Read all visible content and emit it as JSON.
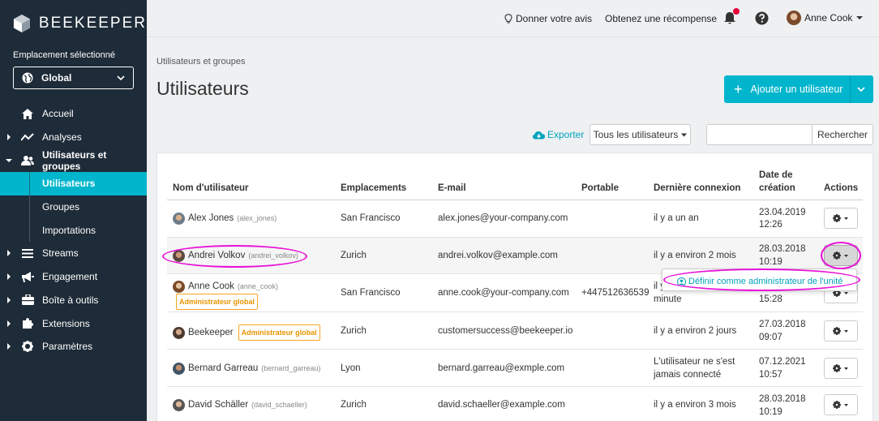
{
  "brand": {
    "name": "BEEKEEPER"
  },
  "sidebar": {
    "location_label": "Emplacement sélectionné",
    "location_value": "Global",
    "items": [
      {
        "label": "Accueil",
        "icon": "home-icon"
      },
      {
        "label": "Analyses",
        "icon": "chart-icon"
      },
      {
        "label": "Utilisateurs et groupes",
        "icon": "users-icon"
      },
      {
        "label": "Utilisateurs"
      },
      {
        "label": "Groupes"
      },
      {
        "label": "Importations"
      },
      {
        "label": "Streams",
        "icon": "streams-icon"
      },
      {
        "label": "Engagement",
        "icon": "megaphone-icon"
      },
      {
        "label": "Boîte à outils",
        "icon": "toolbox-icon"
      },
      {
        "label": "Extensions",
        "icon": "puzzle-icon"
      },
      {
        "label": "Paramètres",
        "icon": "gear-icon"
      }
    ]
  },
  "topbar": {
    "feedback": "Donner votre avis",
    "reward": "Obtenez une récompense",
    "user": "Anne Cook"
  },
  "page": {
    "breadcrumb": "Utilisateurs et groupes",
    "title": "Utilisateurs",
    "add_button": "Ajouter un utilisateur",
    "export": "Exporter",
    "filter": "Tous les utilisateurs",
    "search_placeholder": "",
    "search_button": "Rechercher"
  },
  "table": {
    "headers": {
      "username": "Nom d'utilisateur",
      "locations": "Emplacements",
      "email": "E-mail",
      "mobile": "Portable",
      "last_login": "Dernière connexion",
      "created_line1": "Date de",
      "created_line2": "création",
      "actions": "Actions"
    },
    "rows": [
      {
        "name": "Alex Jones",
        "handle": "(alex_jones)",
        "location": "San Francisco",
        "email": "alex.jones@your-company.com",
        "mobile": "",
        "last_login_1": "il y a un an",
        "last_login_2": "",
        "date": "23.04.2019",
        "time": "12:26"
      },
      {
        "name": "Andrei Volkov",
        "handle": "(andrei_volkov)",
        "location": "Zurich",
        "email": "andrei.volkov@example.com",
        "mobile": "",
        "last_login_1": "il y a environ 2 mois",
        "last_login_2": "",
        "date": "28.03.2018",
        "time": "10:19"
      },
      {
        "name": "Anne Cook",
        "handle": "(anne_cook)",
        "badge": "Administrateur global",
        "location": "San Francisco",
        "email": "anne.cook@your-company.com",
        "mobile": "+447512636539",
        "last_login_1": "il y",
        "last_login_2": "minute",
        "date": "",
        "time": "15:28"
      },
      {
        "name": "Beekeeper",
        "handle": "",
        "badge": "Administrateur global",
        "location": "Zurich",
        "email": "customersuccess@beekeeper.io",
        "mobile": "",
        "last_login_1": "il y a environ 2 jours",
        "last_login_2": "",
        "date": "27.03.2018",
        "time": "09:07"
      },
      {
        "name": "Bernard Garreau",
        "handle": "(bernard_garreau)",
        "location": "Lyon",
        "email": "bernard.garreau@exmple.com",
        "mobile": "",
        "last_login_1": "L'utilisateur ne s'est",
        "last_login_2": "jamais connecté",
        "date": "07.12.2021",
        "time": "10:57"
      },
      {
        "name": "David Schäller",
        "handle": "(david_schaeller)",
        "location": "Zurich",
        "email": "david.schaeller@example.com",
        "mobile": "",
        "last_login_1": "il y a environ 3 mois",
        "last_login_2": "",
        "date": "28.03.2018",
        "time": "10:19"
      }
    ]
  },
  "dropdown": {
    "item": "Définir comme administrateur de l'unité"
  },
  "colors": {
    "accent": "#00b5cc",
    "sidebar": "#1e2b38",
    "highlight": "#e812d8",
    "badge": "#f5a623"
  }
}
